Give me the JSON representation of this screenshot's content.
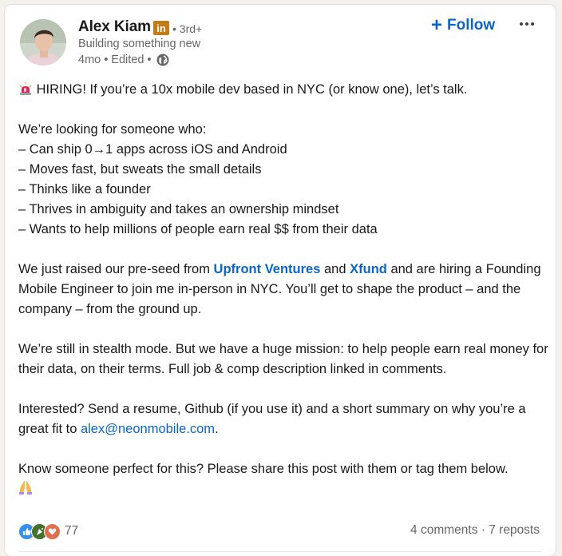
{
  "author": {
    "name": "Alex Kiam",
    "degree": "3rd+",
    "headline": "Building something new",
    "time": "4mo",
    "edited": "Edited"
  },
  "actions": {
    "follow_label": "Follow"
  },
  "post": {
    "intro": "HIRING! If you’re a 10x mobile dev based in NYC (or know one), let’s talk.",
    "looking_for": "We’re looking for someone who:",
    "bullets": [
      "– Can ship 0→1 apps across iOS and Android",
      "– Moves fast, but sweats the small details",
      "– Thinks like a founder",
      "– Thrives in ambiguity and takes an ownership mindset",
      "– Wants to help millions of people earn real $$ from their data"
    ],
    "para2": {
      "part1": "We just raised our pre-seed from ",
      "link1": "Upfront Ventures",
      "part2": " and ",
      "link2": "Xfund",
      "part3": " and are hiring a Founding Mobile Engineer to join me in-person in NYC. You’ll get to shape the product – and the company – from the ground up."
    },
    "para3": "We’re still in stealth mode. But we have a huge mission: to help people earn real money for their data, on their terms. Full job & comp description linked in comments.",
    "para4": {
      "part1": "Interested? Send a resume, Github (if you use it) and a short summary on why you’re a great fit to ",
      "email": "alex@neonmobile.com",
      "part2": "."
    },
    "para5": "Know someone perfect for this? Please share this post with them or tag them below."
  },
  "social": {
    "reaction_count": "77",
    "comments": "4 comments",
    "separator": " · ",
    "reposts": "7 reposts"
  },
  "colors": {
    "accent": "#0a66c2",
    "secondary_text": "#666666",
    "linkedin_badge": "#c37d16"
  },
  "icons": {
    "siren": "rotating-light-icon",
    "globe": "globe-icon",
    "pray": "folded-hands-icon",
    "reactions": [
      "like-icon",
      "celebrate-icon",
      "love-icon"
    ]
  }
}
